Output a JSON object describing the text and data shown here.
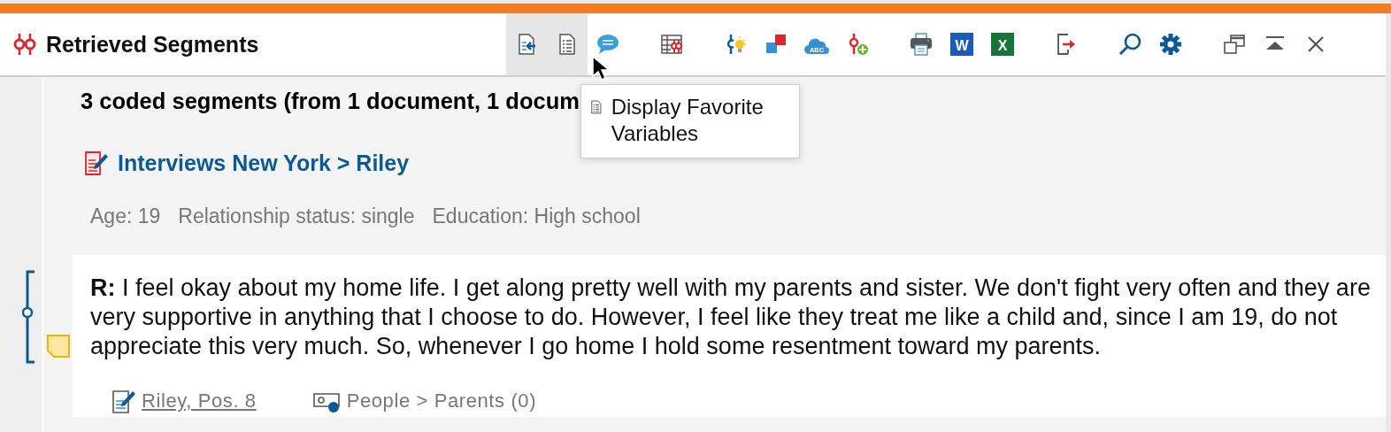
{
  "window": {
    "title": "Retrieved Segments"
  },
  "toolbar": [
    {
      "kind": "import-doc",
      "highlighted": true
    },
    {
      "kind": "list-doc",
      "highlighted": true
    },
    {
      "kind": "comment",
      "highlighted": false
    },
    {
      "kind": "table-codes",
      "highlighted": false
    },
    {
      "kind": "code-idea",
      "highlighted": false
    },
    {
      "kind": "squares",
      "highlighted": false
    },
    {
      "kind": "cloud",
      "label": "ABC",
      "highlighted": false
    },
    {
      "kind": "code-add",
      "highlighted": false
    },
    {
      "kind": "print",
      "highlighted": false
    },
    {
      "kind": "word",
      "label": "W",
      "highlighted": false
    },
    {
      "kind": "excel",
      "label": "X",
      "highlighted": false
    },
    {
      "kind": "export",
      "highlighted": false
    },
    {
      "kind": "search",
      "highlighted": false
    },
    {
      "kind": "settings",
      "highlighted": false
    },
    {
      "kind": "undock",
      "highlighted": false
    },
    {
      "kind": "collapse",
      "highlighted": false
    },
    {
      "kind": "close",
      "highlighted": false
    }
  ],
  "tooltip": {
    "text": "Display Favorite Variables"
  },
  "summary": "3 coded segments (from 1 document, 1 docum",
  "document": {
    "title": "Interviews New York > Riley",
    "variables": [
      "Age: 19",
      "Relationship status: single",
      "Education: High school"
    ]
  },
  "segments": [
    {
      "text": "**R:** I feel okay about my home life. I get along pretty well with my parents and sister. We don't fight very often and they are very supportive in anything that I choose to do. However, I feel like they treat me like a child and, since I am 19, do not appreciate this very much. So, whenever I go home I hold some resentment toward my parents.",
      "has_memo": true,
      "source": "Riley, Pos. 8",
      "code": "People > Parents (0)"
    }
  ]
}
